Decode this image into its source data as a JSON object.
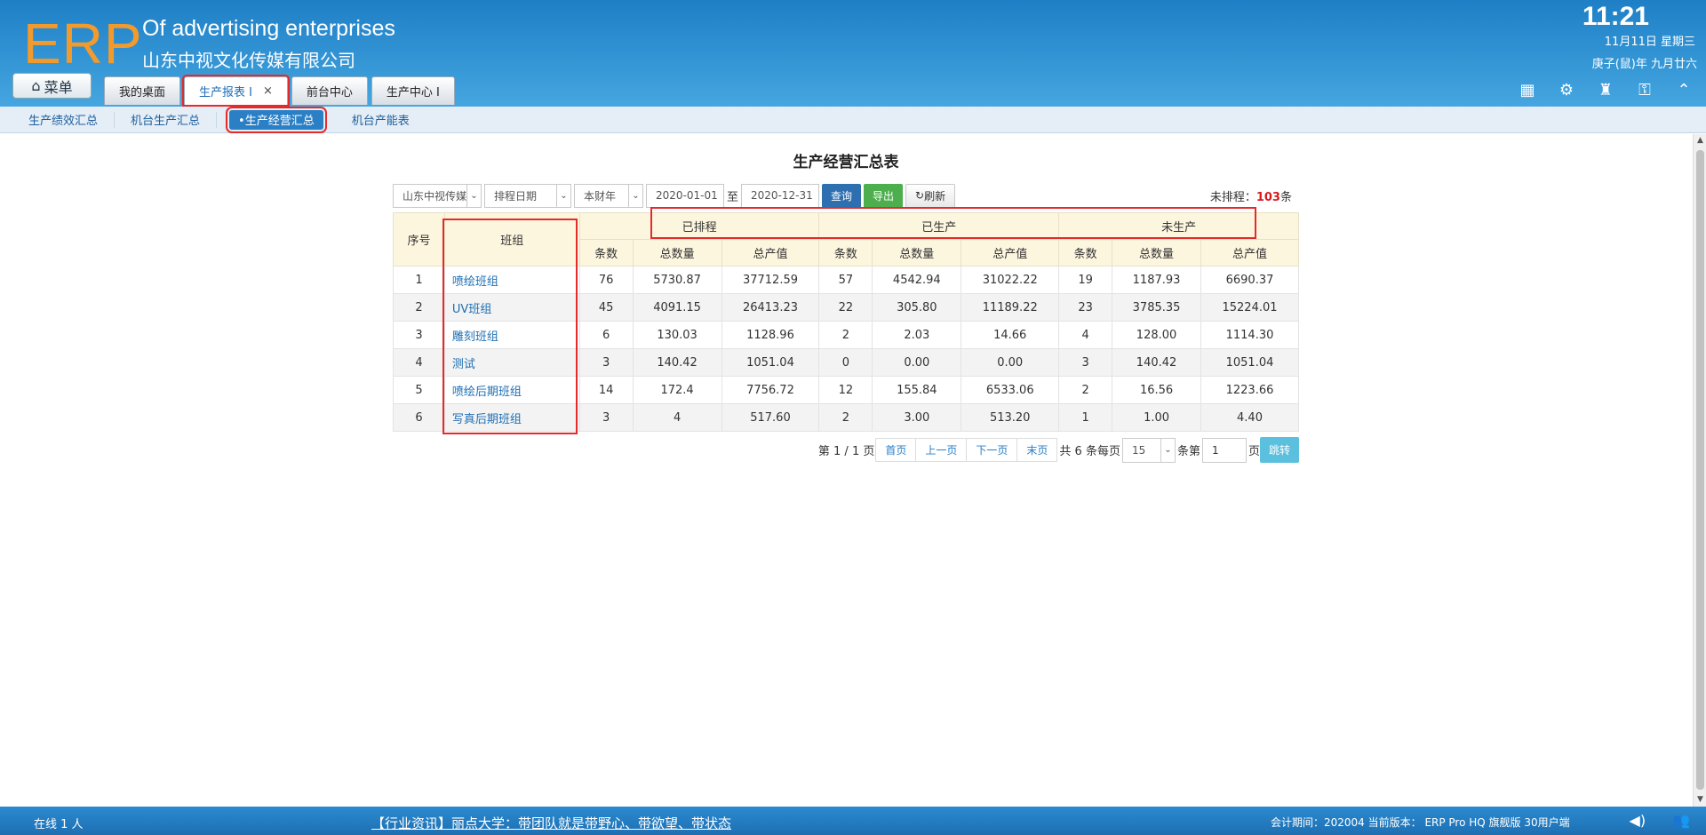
{
  "header": {
    "logo": "ERP",
    "brand_en": "Of advertising enterprises",
    "brand_cn": "山东中视文化传媒有限公司",
    "time": "11:21",
    "date": "11月11日 星期三",
    "lunar": "庚子(鼠)年 九月廿六",
    "menu_label": "菜单"
  },
  "tabs": [
    {
      "label": "我的桌面"
    },
    {
      "label": "生产报表 I",
      "close": "×"
    },
    {
      "label": "前台中心"
    },
    {
      "label": "生产中心 I"
    }
  ],
  "subnav": [
    "生产绩效汇总",
    "机台生产汇总",
    "•生产经营汇总",
    "机台产能表"
  ],
  "report": {
    "title": "生产经营汇总表",
    "filters": {
      "company": "山东中视传媒",
      "date_type": "排程日期",
      "period": "本财年",
      "start": "2020-01-01",
      "to": "至",
      "end": "2020-12-31",
      "query": "查询",
      "export": "导出",
      "refresh": "刷新"
    },
    "unscheduled_label": "未排程：",
    "unscheduled_count": "103",
    "unscheduled_unit": "条",
    "headers": {
      "seq": "序号",
      "group": "班组",
      "scheduled": "已排程",
      "produced": "已生产",
      "unproduced": "未生产",
      "count": "条数",
      "qty": "总数量",
      "value": "总产值"
    },
    "rows": [
      {
        "seq": "1",
        "group": "喷绘班组",
        "c1": "76",
        "q1": "5730.87",
        "v1": "37712.59",
        "c2": "57",
        "q2": "4542.94",
        "v2": "31022.22",
        "c3": "19",
        "q3": "1187.93",
        "v3": "6690.37"
      },
      {
        "seq": "2",
        "group": "UV班组",
        "c1": "45",
        "q1": "4091.15",
        "v1": "26413.23",
        "c2": "22",
        "q2": "305.80",
        "v2": "11189.22",
        "c3": "23",
        "q3": "3785.35",
        "v3": "15224.01"
      },
      {
        "seq": "3",
        "group": "雕刻班组",
        "c1": "6",
        "q1": "130.03",
        "v1": "1128.96",
        "c2": "2",
        "q2": "2.03",
        "v2": "14.66",
        "c3": "4",
        "q3": "128.00",
        "v3": "1114.30"
      },
      {
        "seq": "4",
        "group": "测试",
        "c1": "3",
        "q1": "140.42",
        "v1": "1051.04",
        "c2": "0",
        "q2": "0.00",
        "v2": "0.00",
        "c3": "3",
        "q3": "140.42",
        "v3": "1051.04"
      },
      {
        "seq": "5",
        "group": "喷绘后期班组",
        "c1": "14",
        "q1": "172.4",
        "v1": "7756.72",
        "c2": "12",
        "q2": "155.84",
        "v2": "6533.06",
        "c3": "2",
        "q3": "16.56",
        "v3": "1223.66"
      },
      {
        "seq": "6",
        "group": "写真后期班组",
        "c1": "3",
        "q1": "4",
        "v1": "517.60",
        "c2": "2",
        "q2": "3.00",
        "v2": "513.20",
        "c3": "1",
        "q3": "1.00",
        "v3": "4.40"
      }
    ],
    "pager": {
      "page_info": "第 1 / 1 页",
      "first": "首页",
      "prev": "上一页",
      "next": "下一页",
      "last": "末页",
      "total": "共 6 条每页",
      "page_size": "15",
      "size_unit": "条第",
      "page_no": "1",
      "page_unit": "页",
      "go": "跳转"
    }
  },
  "footer": {
    "online": "在线   1   人",
    "news": "【行业资讯】丽点大学：带团队就是带野心、带欲望、带状态",
    "version": "会计期间：202004 当前版本： ERP Pro HQ 旗舰版 30用户端"
  },
  "colors": {
    "header": "#2a8fd4",
    "logo": "#f39a2c",
    "highlight": "#e52a2a",
    "link": "#1e6fb5"
  }
}
